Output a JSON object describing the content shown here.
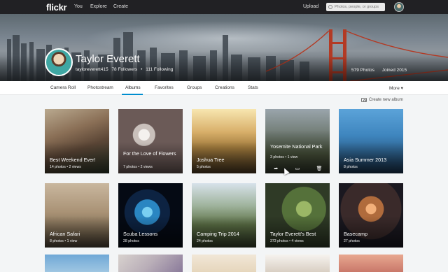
{
  "topnav": {
    "logo": "flickr",
    "links": [
      "You",
      "Explore",
      "Create"
    ],
    "upload": "Upload",
    "search_placeholder": "Photos, people, or groups"
  },
  "profile": {
    "name": "Taylor Everett",
    "username": "tayloreverett415",
    "followers": "78 Followers",
    "separator": "•",
    "following": "111 Following",
    "photos": "579 Photos",
    "joined": "Joined 2015"
  },
  "tabs": [
    "Camera Roll",
    "Photostream",
    "Albums",
    "Favorites",
    "Groups",
    "Creations",
    "Stats"
  ],
  "active_tab": "Albums",
  "more": "More ▾",
  "create_album": "Create new album",
  "albums": [
    {
      "title": "Best Weekend Ever!",
      "meta": "14 photos • 2 views"
    },
    {
      "title": "For the Love of Flowers",
      "meta": "7 photos • 2 views"
    },
    {
      "title": "Joshua Tree",
      "meta": "5 photos"
    },
    {
      "title": "Yosemite National Park",
      "meta": "3 photos • 1 view"
    },
    {
      "title": "Asia Summer 2013",
      "meta": "8 photos"
    },
    {
      "title": "African Safari",
      "meta": "8 photos • 1 view"
    },
    {
      "title": "Scuba Lessons",
      "meta": "28 photos"
    },
    {
      "title": "Camping Trip 2014",
      "meta": "24 photos"
    },
    {
      "title": "Taylor Everett's Best",
      "meta": "373 photos • 4 views"
    },
    {
      "title": "Basecamp",
      "meta": "27 photos"
    }
  ],
  "colors": {
    "topbar": "#212124",
    "accent": "#008ecf",
    "page_bg": "#f3f5f6"
  }
}
